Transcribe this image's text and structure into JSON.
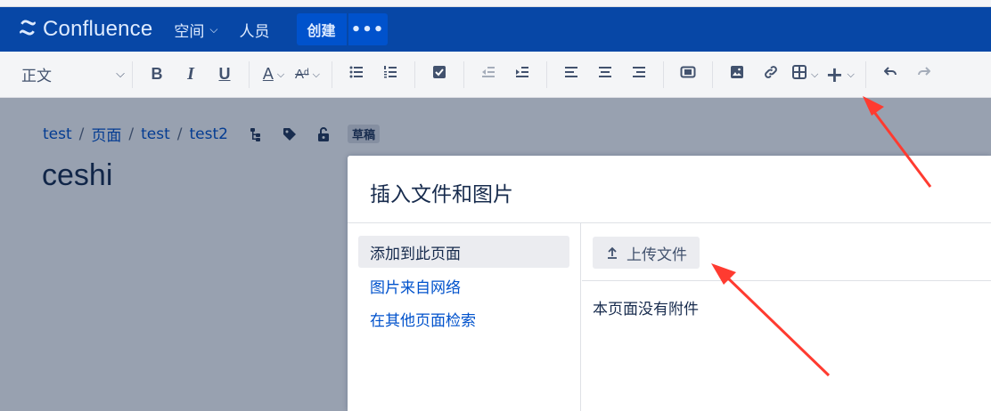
{
  "header": {
    "logo_text": "Confluence",
    "nav": [
      {
        "label": "空间",
        "has_dropdown": true
      },
      {
        "label": "人员",
        "has_dropdown": false
      }
    ],
    "create_label": "创建",
    "more_label": "•••"
  },
  "toolbar": {
    "paragraph_style": "正文",
    "buttons": [
      "bold-icon",
      "italic-icon",
      "underline-icon",
      "text-color-icon",
      "more-formatting-icon",
      "bullet-list-icon",
      "numbered-list-icon",
      "task-list-icon",
      "outdent-icon",
      "indent-icon",
      "align-left-icon",
      "align-center-icon",
      "align-right-icon",
      "page-layout-icon",
      "insert-image-icon",
      "insert-link-icon",
      "insert-table-icon",
      "insert-more-icon",
      "undo-icon",
      "redo-icon"
    ]
  },
  "breadcrumb": {
    "items": [
      "test",
      "页面",
      "test",
      "test2"
    ],
    "separator": "/",
    "draft_badge": "草稿"
  },
  "page": {
    "title": "ceshi"
  },
  "dialog": {
    "title": "插入文件和图片",
    "side_items": [
      {
        "label": "添加到此页面",
        "active": true
      },
      {
        "label": "图片来自网络",
        "active": false
      },
      {
        "label": "在其他页面检索",
        "active": false
      }
    ],
    "upload_label": "上传文件",
    "empty_message": "本页面没有附件"
  },
  "colors": {
    "header_bg": "#0747a6",
    "button_bg": "#0052cc",
    "link": "#0052cc",
    "annotation_arrow": "#ff3b30"
  }
}
